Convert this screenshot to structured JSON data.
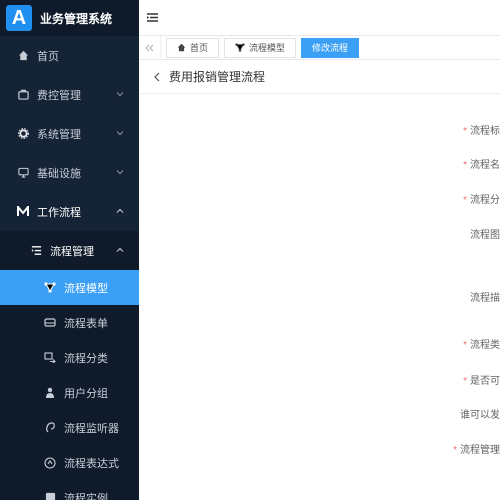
{
  "app": {
    "logo_letter": "A",
    "title": "业务管理系统"
  },
  "sidebar": {
    "items": [
      {
        "label": "首页",
        "icon": "home-icon"
      },
      {
        "label": "费控管理",
        "icon": "wallet-icon"
      },
      {
        "label": "系统管理",
        "icon": "gear-icon"
      },
      {
        "label": "基础设施",
        "icon": "monitor-icon"
      },
      {
        "label": "工作流程",
        "icon": "workflow-icon"
      }
    ],
    "submenu": {
      "label": "流程管理",
      "icon": "list-icon"
    },
    "leaves": [
      {
        "label": "流程模型",
        "icon": "model-icon"
      },
      {
        "label": "流程表单",
        "icon": "form-icon"
      },
      {
        "label": "流程分类",
        "icon": "category-icon"
      },
      {
        "label": "用户分组",
        "icon": "user-group-icon"
      },
      {
        "label": "流程监听器",
        "icon": "listener-icon"
      },
      {
        "label": "流程表达式",
        "icon": "expression-icon"
      },
      {
        "label": "流程实例",
        "icon": "instance-icon"
      }
    ],
    "active_leaf": "流程模型"
  },
  "header": {
    "menu_icon": "hamburger-icon"
  },
  "tabs": [
    {
      "label": "首页",
      "icon": "home-icon"
    },
    {
      "label": "流程模型",
      "icon": "model-icon"
    },
    {
      "label": "修改流程",
      "icon": ""
    }
  ],
  "page": {
    "title": "费用报销管理流程",
    "fields": [
      {
        "label": "流程标",
        "required": true
      },
      {
        "label": "流程名",
        "required": true
      },
      {
        "label": "流程分",
        "required": true
      },
      {
        "label": "流程图",
        "required": false
      },
      {
        "label": "流程描",
        "required": false
      },
      {
        "label": "流程类",
        "required": true
      },
      {
        "label": "是否可",
        "required": true
      },
      {
        "label": "谁可以发",
        "required": false
      },
      {
        "label": "流程管理",
        "required": true
      }
    ]
  },
  "colors": {
    "sidebar_bg": "#152336",
    "accent": "#3a9ff5",
    "required": "#f56c6c"
  }
}
